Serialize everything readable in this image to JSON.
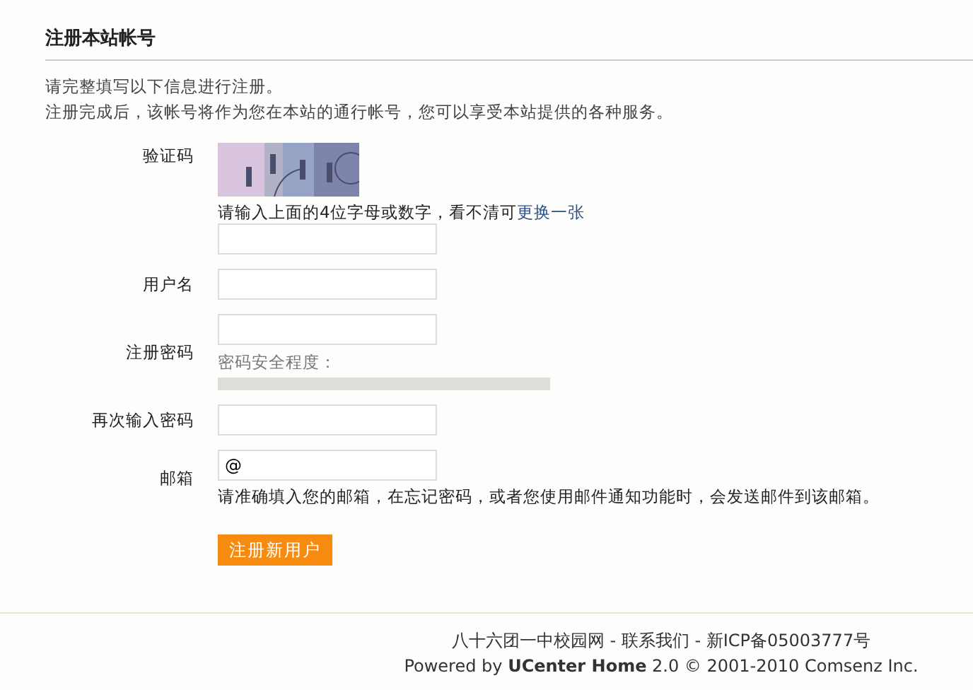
{
  "title": "注册本站帐号",
  "intro": [
    "请完整填写以下信息进行注册。",
    "注册完成后，该帐号将作为您在本站的通行帐号，您可以享受本站提供的各种服务。"
  ],
  "fields": [
    {
      "kind": "captcha",
      "label": "验证码",
      "hint": "请输入上面的4位字母或数字，看不清可",
      "link": "更换一张"
    },
    {
      "kind": "text",
      "label": "用户名"
    },
    {
      "kind": "password",
      "label": "注册密码",
      "strength_label": "密码安全程度：",
      "level": 0
    },
    {
      "kind": "text",
      "label": "再次输入密码"
    },
    {
      "kind": "email",
      "label": "邮箱",
      "value": "@",
      "hint": "请准确填入您的邮箱，在忘记密码，或者您使用邮件通知功能时，会发送邮件到该邮箱。"
    }
  ],
  "submit": "注册新用户",
  "footer": {
    "site": "八十六团一中校园网 -",
    "contact": "联系我们",
    "icp": "- 新ICP备05003777号",
    "powered": "Powered by **UCenter Home** 2.0 © 2001-2010 Comsenz Inc."
  }
}
